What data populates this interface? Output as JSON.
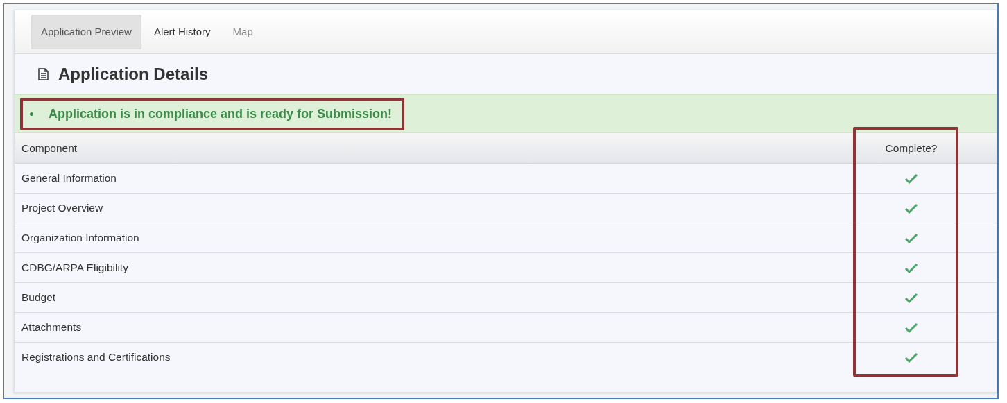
{
  "tabs": [
    {
      "label": "Application Preview",
      "selected": true
    },
    {
      "label": "Alert History",
      "selected": false
    },
    {
      "label": "Map",
      "selected": false,
      "disabled": true
    }
  ],
  "title": "Application Details",
  "alert": {
    "items": [
      "Application is in compliance and is ready for Submission!"
    ]
  },
  "table": {
    "columns": [
      "Component",
      "Complete?"
    ],
    "rows": [
      {
        "component": "General Information",
        "complete": true
      },
      {
        "component": "Project Overview",
        "complete": true
      },
      {
        "component": "Organization Information",
        "complete": true
      },
      {
        "component": "CDBG/ARPA Eligibility",
        "complete": true
      },
      {
        "component": "Budget",
        "complete": true
      },
      {
        "component": "Attachments",
        "complete": true
      },
      {
        "component": "Registrations and Certifications",
        "complete": true
      }
    ]
  }
}
